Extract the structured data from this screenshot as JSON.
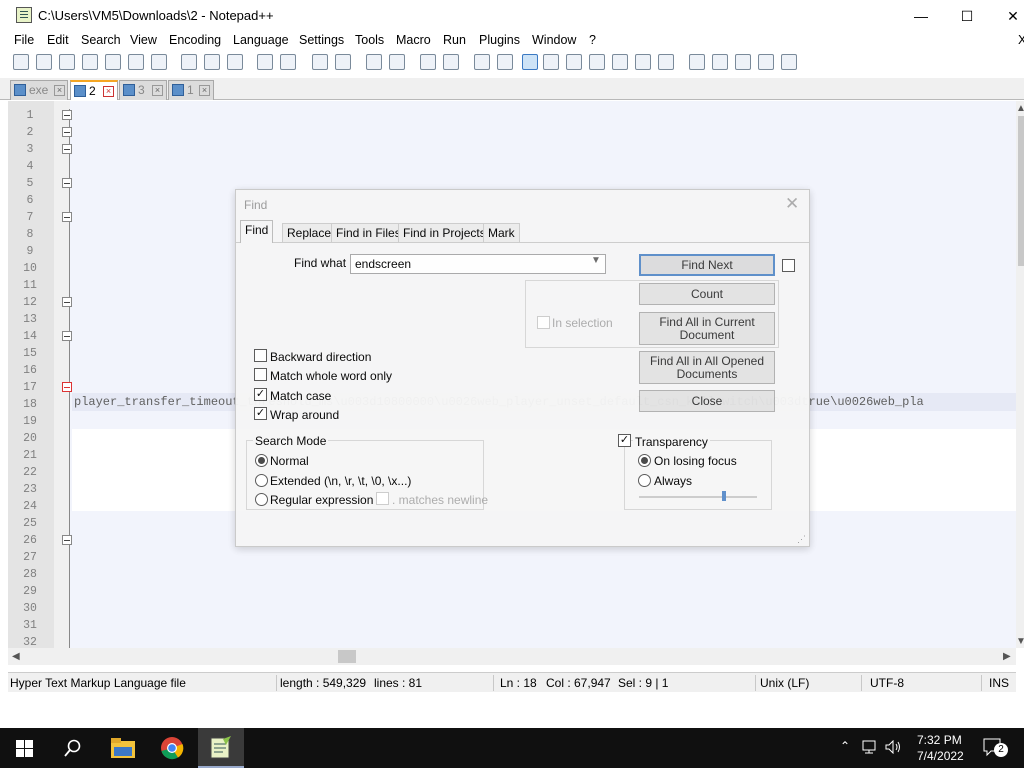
{
  "window": {
    "title": "C:\\Users\\VM5\\Downloads\\2 - Notepad++",
    "minimize": "—",
    "maximize": "☐",
    "close": "✕"
  },
  "menu": [
    "File",
    "Edit",
    "Search",
    "View",
    "Encoding",
    "Language",
    "Settings",
    "Tools",
    "Macro",
    "Run",
    "Plugins",
    "Window",
    "?"
  ],
  "menu_close": "X",
  "tabs": [
    {
      "label": "exe",
      "active": false
    },
    {
      "label": "2",
      "active": true
    },
    {
      "label": "3",
      "active": false
    },
    {
      "label": "1",
      "active": false
    }
  ],
  "editor": {
    "line_numbers": [
      "1",
      "2",
      "3",
      "4",
      "5",
      "6",
      "7",
      "8",
      "9",
      "10",
      "11",
      "12",
      "13",
      "14",
      "15",
      "16",
      "17",
      "18",
      "19",
      "20",
      "21",
      "22",
      "23",
      "24",
      "25",
      "26",
      "27",
      "28",
      "29",
      "30",
      "31",
      "32"
    ],
    "line18_text": "player_transfer_timeout_threshold_ms\\u003d10800000\\u0026web_player_unset_default_csn_killswitch\\u003dtrue\\u0026web_pla"
  },
  "statusbar": {
    "file_type": "Hyper Text Markup Language file",
    "length": "length : 549,329",
    "lines": "lines : 81",
    "ln": "Ln : 18",
    "col": "Col : 67,947",
    "sel": "Sel : 9 | 1",
    "eol": "Unix (LF)",
    "encoding": "UTF-8",
    "mode": "INS"
  },
  "find_dialog": {
    "title": "Find",
    "tabs": [
      "Find",
      "Replace",
      "Find in Files",
      "Find in Projects",
      "Mark"
    ],
    "find_what_label": "Find what :",
    "find_what_value": "endscreen",
    "buttons": {
      "find_next": "Find Next",
      "count": "Count",
      "find_all_current_1": "Find All in Current",
      "find_all_current_2": "Document",
      "find_all_opened_1": "Find All in All Opened",
      "find_all_opened_2": "Documents",
      "close": "Close"
    },
    "in_selection": "In selection",
    "options": {
      "backward": "Backward direction",
      "whole_word": "Match whole word only",
      "match_case": "Match case",
      "wrap_around": "Wrap around"
    },
    "search_mode": {
      "title": "Search Mode",
      "normal": "Normal",
      "extended": "Extended (\\n, \\r, \\t, \\0, \\x...)",
      "regex": "Regular expression",
      "matches_newline": ". matches newline"
    },
    "transparency": {
      "title": "Transparency",
      "on_losing_focus": "On losing focus",
      "always": "Always",
      "level": 0.7
    }
  },
  "taskbar": {
    "time": "7:32 PM",
    "date": "7/4/2022",
    "notifications": "2"
  }
}
